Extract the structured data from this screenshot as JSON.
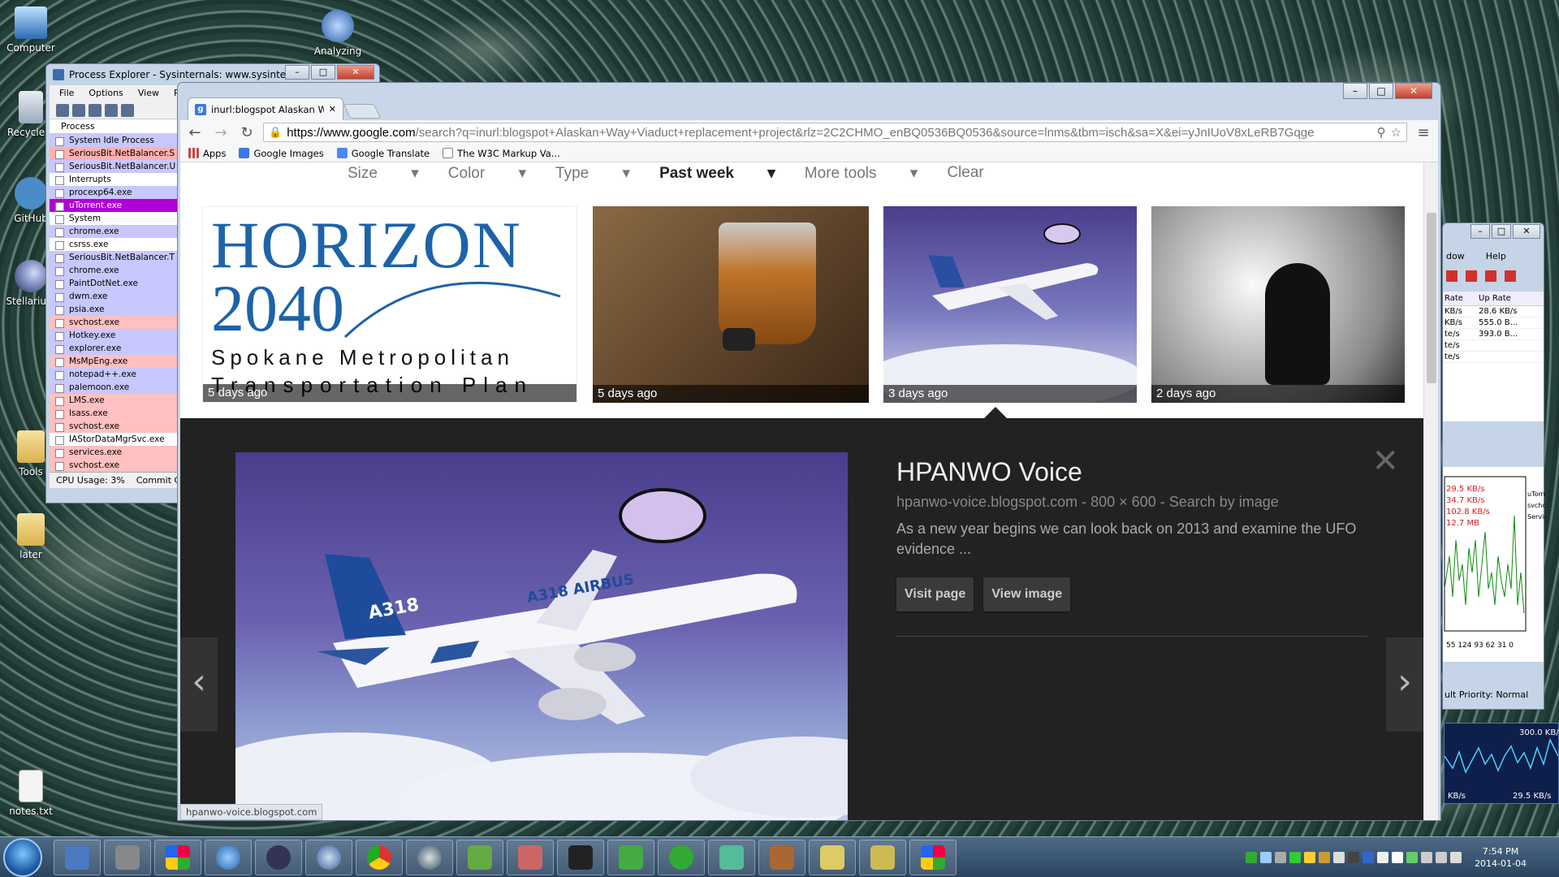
{
  "desktop": {
    "icons": [
      {
        "label": "Computer"
      },
      {
        "label": "Recycle B"
      },
      {
        "label": "GitHub"
      },
      {
        "label": "Stellarium"
      },
      {
        "label": "Tools"
      },
      {
        "label": "later"
      },
      {
        "label": "notes.txt"
      },
      {
        "label": "Analyzing"
      }
    ]
  },
  "procexp": {
    "title": "Process Explorer - Sysinternals: www.sysinternals.c...",
    "menu": [
      "File",
      "Options",
      "View",
      "Pro"
    ],
    "column": "Process",
    "rows": [
      {
        "name": "System Idle Process",
        "color": "#c8c8ff"
      },
      {
        "name": "SeriousBit.NetBalancer.S",
        "color": "#ffb0b0"
      },
      {
        "name": "SeriousBit.NetBalancer.U",
        "color": "#c8c8ff"
      },
      {
        "name": "Interrupts",
        "color": "#ffffff"
      },
      {
        "name": "procexp64.exe",
        "color": "#c8c8ff"
      },
      {
        "name": "uTorrent.exe",
        "color": "#b000d8"
      },
      {
        "name": "System",
        "color": "#ffffff"
      },
      {
        "name": "chrome.exe",
        "color": "#c8c8ff"
      },
      {
        "name": "csrss.exe",
        "color": "#ffffff"
      },
      {
        "name": "SeriousBit.NetBalancer.T",
        "color": "#c8c8ff"
      },
      {
        "name": "chrome.exe",
        "color": "#c8c8ff"
      },
      {
        "name": "PaintDotNet.exe",
        "color": "#c8c8ff"
      },
      {
        "name": "dwm.exe",
        "color": "#c8c8ff"
      },
      {
        "name": "psia.exe",
        "color": "#c8c8ff"
      },
      {
        "name": "svchost.exe",
        "color": "#ffc0c0"
      },
      {
        "name": "Hotkey.exe",
        "color": "#c8c8ff"
      },
      {
        "name": "explorer.exe",
        "color": "#c8c8ff"
      },
      {
        "name": "MsMpEng.exe",
        "color": "#ffc0c0"
      },
      {
        "name": "notepad++.exe",
        "color": "#c8c8ff"
      },
      {
        "name": "palemoon.exe",
        "color": "#c8c8ff"
      },
      {
        "name": "LMS.exe",
        "color": "#ffc0c0"
      },
      {
        "name": "lsass.exe",
        "color": "#ffc0c0"
      },
      {
        "name": "svchost.exe",
        "color": "#ffc0c0"
      },
      {
        "name": "IAStorDataMgrSvc.exe",
        "color": "#ffffff"
      },
      {
        "name": "services.exe",
        "color": "#ffc0c0"
      },
      {
        "name": "svchost.exe",
        "color": "#ffc0c0"
      }
    ],
    "status_cpu": "CPU Usage: 3%",
    "status_commit": "Commit C"
  },
  "sideapp": {
    "menu": [
      "dow",
      "Help"
    ],
    "cols": [
      "Rate",
      "Up Rate"
    ],
    "rows": [
      {
        "a": "KB/s",
        "b": "28.6 KB/s"
      },
      {
        "a": "KB/s",
        "b": "555.0 B..."
      },
      {
        "a": "te/s",
        "b": "393.0 B..."
      },
      {
        "a": "te/s",
        "b": ""
      },
      {
        "a": "te/s",
        "b": ""
      }
    ],
    "graph_labels": [
      "29.5 KB/s",
      "34.7 KB/s",
      "102.8 KB/s",
      "12.7 MB"
    ],
    "legend": [
      "uTorre",
      "svchos",
      "Servic"
    ],
    "axis": "55 124 93 62 31 0",
    "priority": "ult Priority: Normal"
  },
  "netmeter": {
    "top": "300.0 KB/s",
    "down": "KB/s",
    "up": "29.5 KB/s"
  },
  "chrome": {
    "tab_title": "inurl:blogspot Alaskan W",
    "url_domain": "https://www.google.com",
    "url_rest": "/search?q=inurl:blogspot+Alaskan+Way+Viaduct+replacement+project&rlz=2C2CHMO_enBQ0536BQ0536&source=lnms&tbm=isch&sa=X&ei=yJnIUoV8xLeRB7Gqge",
    "bookmarks": [
      "Apps",
      "Google Images",
      "Google Translate",
      "The W3C Markup Va..."
    ],
    "filters": [
      "Size",
      "Color",
      "Type",
      "Past week",
      "More tools",
      "Clear"
    ],
    "thumbs": [
      {
        "caption": "5 days ago",
        "line1": "HORIZON",
        "line2": "2040",
        "line3": "Spokane Metropolitan",
        "line4": "Transportation Plan"
      },
      {
        "caption": "5 days ago"
      },
      {
        "caption": "3 days ago"
      },
      {
        "caption": "2 days ago"
      }
    ],
    "panel": {
      "title": "HPANWO Voice",
      "meta": "hpanwo-voice.blogspot.com - 800 × 600 - Search by image",
      "desc": "As a new year begins we can look back on 2013 and examine the UFO evidence ...",
      "visit": "Visit page",
      "view": "View image",
      "plane_tail": "A318",
      "plane_brand": "A318 AIRBUS"
    },
    "status_url": "hpanwo-voice.blogspot.com"
  },
  "taskbar": {
    "clock_time": "7:54 PM",
    "clock_date": "2014-01-04"
  }
}
